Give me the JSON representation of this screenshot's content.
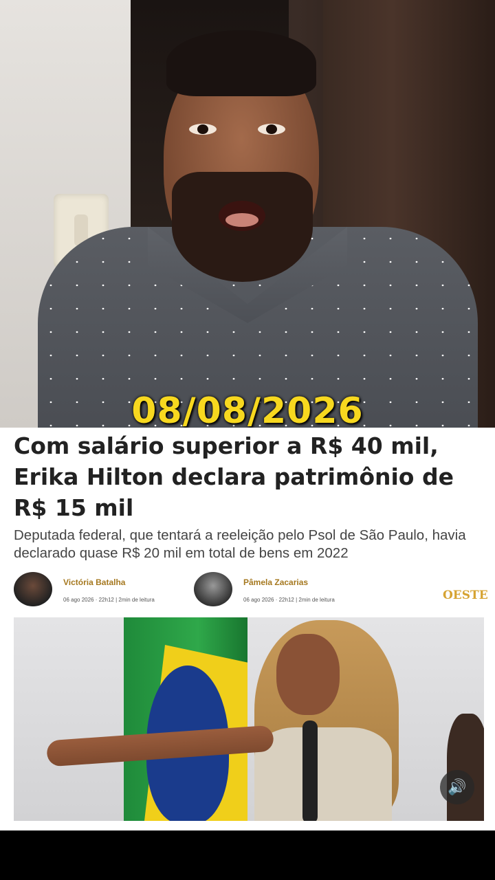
{
  "video": {
    "date_overlay": "08/08/2026"
  },
  "article": {
    "headline": "Com salário superior a R$ 40 mil, Erika Hilton declara patrimônio de R$ 15 mil",
    "subtitle": "Deputada federal, que tentará a reeleição pelo Psol de São Paulo, havia declarado quase R$ 20 mil em total de bens em 2022",
    "authors": [
      {
        "name": "Victória Batalha",
        "meta": "06 ago 2026 · 22h12 | 2min de leitura"
      },
      {
        "name": "Pâmela Zacarias",
        "meta": "06 ago 2026 · 22h12 | 2min de leitura"
      }
    ],
    "brand": "OESTE"
  },
  "controls": {
    "sound_icon": "speaker-icon",
    "sound_glyph": "🔊"
  },
  "colors": {
    "date_overlay": "#f7d81f",
    "author_name": "#a5781f",
    "brand": "#d6a332"
  }
}
